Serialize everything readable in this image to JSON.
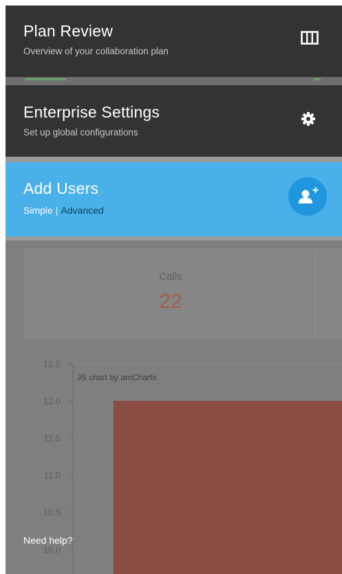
{
  "menu": {
    "plan_review": {
      "title": "Plan Review",
      "subtitle": "Overview of your collaboration plan",
      "icon": "columns-icon"
    },
    "enterprise_settings": {
      "title": "Enterprise Settings",
      "subtitle": "Set up global configurations",
      "icon": "gear-icon"
    },
    "add_users": {
      "title": "Add Users",
      "simple_label": "Simple",
      "separator": "|",
      "advanced_label": "Advanced",
      "icon": "add-user-icon"
    }
  },
  "background": {
    "calls_label": "Calls",
    "calls_value": "22"
  },
  "chart_data": {
    "type": "bar",
    "credit": "JS chart by amCharts",
    "yticks": [
      "12.5",
      "12.0",
      "11.5",
      "11.0",
      "10.5",
      "10.0"
    ],
    "ylim": [
      10.0,
      12.5
    ],
    "values": [
      12.0
    ]
  },
  "footer": {
    "help_link": "Need help?"
  },
  "colors": {
    "panel_dark": "#333333",
    "panel_active": "#49b0ea",
    "add_button": "#1f96dd",
    "bar": "#8b4e45",
    "calls_value": "#a55d48"
  }
}
